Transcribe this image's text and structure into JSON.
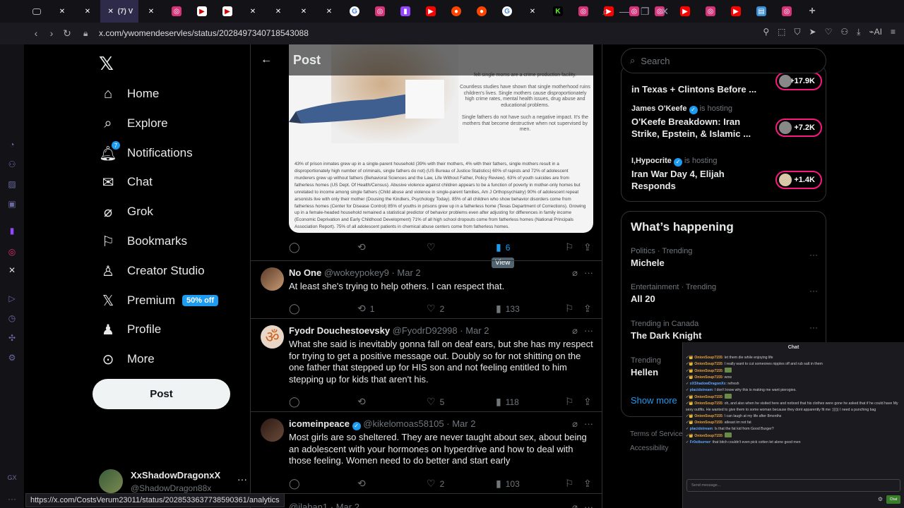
{
  "browser": {
    "active_tab_label": "(7) V",
    "url": "x.com/ywomendeservles/status/2028497340718543088",
    "ai_label": "AI",
    "status_link": "https://x.com/CostsVerum23011/status/2028533637738590361/analytics"
  },
  "sidebar": {
    "nav": [
      {
        "label": "Home",
        "icon": "home-icon"
      },
      {
        "label": "Explore",
        "icon": "search-icon"
      },
      {
        "label": "Notifications",
        "icon": "bell-icon"
      },
      {
        "label": "Chat",
        "icon": "mail-icon"
      },
      {
        "label": "Grok",
        "icon": "grok-icon"
      },
      {
        "label": "Bookmarks",
        "icon": "bookmark-icon"
      },
      {
        "label": "Creator Studio",
        "icon": "creator-icon"
      },
      {
        "label": "Premium",
        "icon": "x-icon"
      },
      {
        "label": "Profile",
        "icon": "person-icon"
      },
      {
        "label": "More",
        "icon": "more-circle-icon"
      }
    ],
    "notification_count": "7",
    "premium_badge": "50% off",
    "post_button": "Post",
    "account": {
      "name": "XxShadowDragonxX",
      "handle": "@ShadowDragon88x"
    }
  },
  "main": {
    "header_title": "Post",
    "image_text": {
      "caption_top": "felt single moms are a crime production facility.",
      "para1": "Countless studies have shown that single motherhood ruins children's lives. Single mothers cause disproportionately high crime rates, mental health issues, drug abuse and educational problems.",
      "para2": "Single fathers do not have such a negative impact. It's the mothers that become destructive when not supervised by men.",
      "stats": "43% of prison inmates grew up in a single-parent household (39% with their mothers, 4% with their fathers, single mothers result in a disproportionately high number of criminals, single fathers do not) (US Bureau of Justice Statistics) 60% of rapists and 72% of adolescent murderers grew up without fathers (Behavioral Sciences and the Law, Life Without Father, Policy Review). 63% of youth suicides are from fatherless homes (US Dept. Of Health/Census). Abusive violence against children appears to be a function of poverty in mother-only homes but unrelated to income among single fathers (Child abuse and violence in single-parent families, Am J Orthopsychiatry) 90% of adolescent repeat arsonists live with only their mother (Dousing the Kindlers, Psychology Today). 85% of all children who show behavior disorders come from fatherless homes (Center for Disease Control) 85% of youths in prisons grew up in a fatherless home (Texas Department of Corrections). Growing up in a female-headed household remained a statistical predictor of behavior problems even after adjusting for differences in family income (Economic Deprivation and Early Childhood Development) 71% of all high school dropouts come from fatherless homes (National Principals Association Report). 75% of all adolescent patients in chemical abuse centers come from fatherless homes."
    },
    "post_stats": {
      "views": "6",
      "tooltip": "View"
    },
    "replies": [
      {
        "name": "No One",
        "handle": "@wokeypokey9",
        "date": "· Mar 2",
        "verified": false,
        "text": "At least she's trying to help others. I can respect that.",
        "replies": "",
        "reposts": "1",
        "likes": "2",
        "views": "133"
      },
      {
        "name": "Fyodr Douchestoevsky",
        "handle": "@FyodrD92998",
        "date": "· Mar 2",
        "verified": false,
        "text": "What she said is inevitably gonna fall on deaf ears, but she has my respect for trying to get a positive message out. Doubly so for not shitting on the one father that stepped up for HIS son and not feeling entitled to him stepping up for kids that aren't his.",
        "replies": "",
        "reposts": "",
        "likes": "5",
        "views": "118"
      },
      {
        "name": "icomeinpeace",
        "handle": "@kikelomoas58105",
        "date": "· Mar 2",
        "verified": true,
        "text": "Most girls are so sheltered. They are never taught about sex, about being an adolescent with your hormones on hyperdrive and how to deal with those feeling. Women need to do better and start early",
        "replies": "",
        "reposts": "",
        "likes": "2",
        "views": "103"
      },
      {
        "name": "",
        "handle": "@jlaban1",
        "date": "· Mar 2",
        "verified": false,
        "text": "",
        "replies": "",
        "reposts": "",
        "likes": "",
        "views": ""
      }
    ]
  },
  "right": {
    "search_placeholder": "Search",
    "spaces": [
      {
        "host": "",
        "hosting": "",
        "title": "in Texas + Clintons Before ...",
        "listeners": "+17.9K"
      },
      {
        "host": "James O'Keefe",
        "hosting": "is hosting",
        "title": "O'Keefe Breakdown: Iran Strike, Epstein, & Islamic ...",
        "listeners": "+7.2K"
      },
      {
        "host": "I,Hypocrite",
        "hosting": "is hosting",
        "title": "Iran War Day 4, Elijah Responds",
        "listeners": "+1.4K"
      }
    ],
    "happening_title": "What’s happening",
    "trends": [
      {
        "context": "Politics · Trending",
        "name": "Michele"
      },
      {
        "context": "Entertainment · Trending",
        "name": "All 20"
      },
      {
        "context": "Trending in Canada",
        "name": "The Dark Knight"
      },
      {
        "context": "Trending",
        "name": "Hellen"
      }
    ],
    "show_more": "Show more",
    "footer_1": "Terms of Service",
    "footer_2": "Accessibility"
  },
  "chat": {
    "title": "Chat",
    "input_placeholder": "Send message...",
    "send_label": "Chat",
    "messages": [
      {
        "user": "OnionSoup7155",
        "text": "let them die while enjoying life"
      },
      {
        "user": "OnionSoup7155",
        "text": "I really want to cut someones nipples off and rub salt in them"
      },
      {
        "user": "OnionSoup7155",
        "text": ""
      },
      {
        "user": "OnionSoup7155",
        "text": "wow"
      },
      {
        "user": "xXShadowDragonXx",
        "text": "refresh"
      },
      {
        "user": "placidstream",
        "text": "I don't know why this is making me want pierogies."
      },
      {
        "user": "OnionSoup7155",
        "text": ""
      },
      {
        "user": "OnionSoup7155",
        "text": "oh, and also when he visited here and noticed that his clothes were gone he asked that if he could have My sexy outfits. He wanted to give them to some woman because they dont apparently fit me :))))) I need a punching bag"
      },
      {
        "user": "OnionSoup7155",
        "text": "I can laugh at my life after 8months"
      },
      {
        "user": "OnionSoup7155",
        "text": "atleast im not fat"
      },
      {
        "user": "placidstream",
        "text": "Is that the fat kid from Good Burger?"
      },
      {
        "user": "OnionSoup7155",
        "text": ""
      },
      {
        "user": "Fr0stburner",
        "text": "that bitch couldn't even pick cotten let alone good men"
      }
    ]
  }
}
